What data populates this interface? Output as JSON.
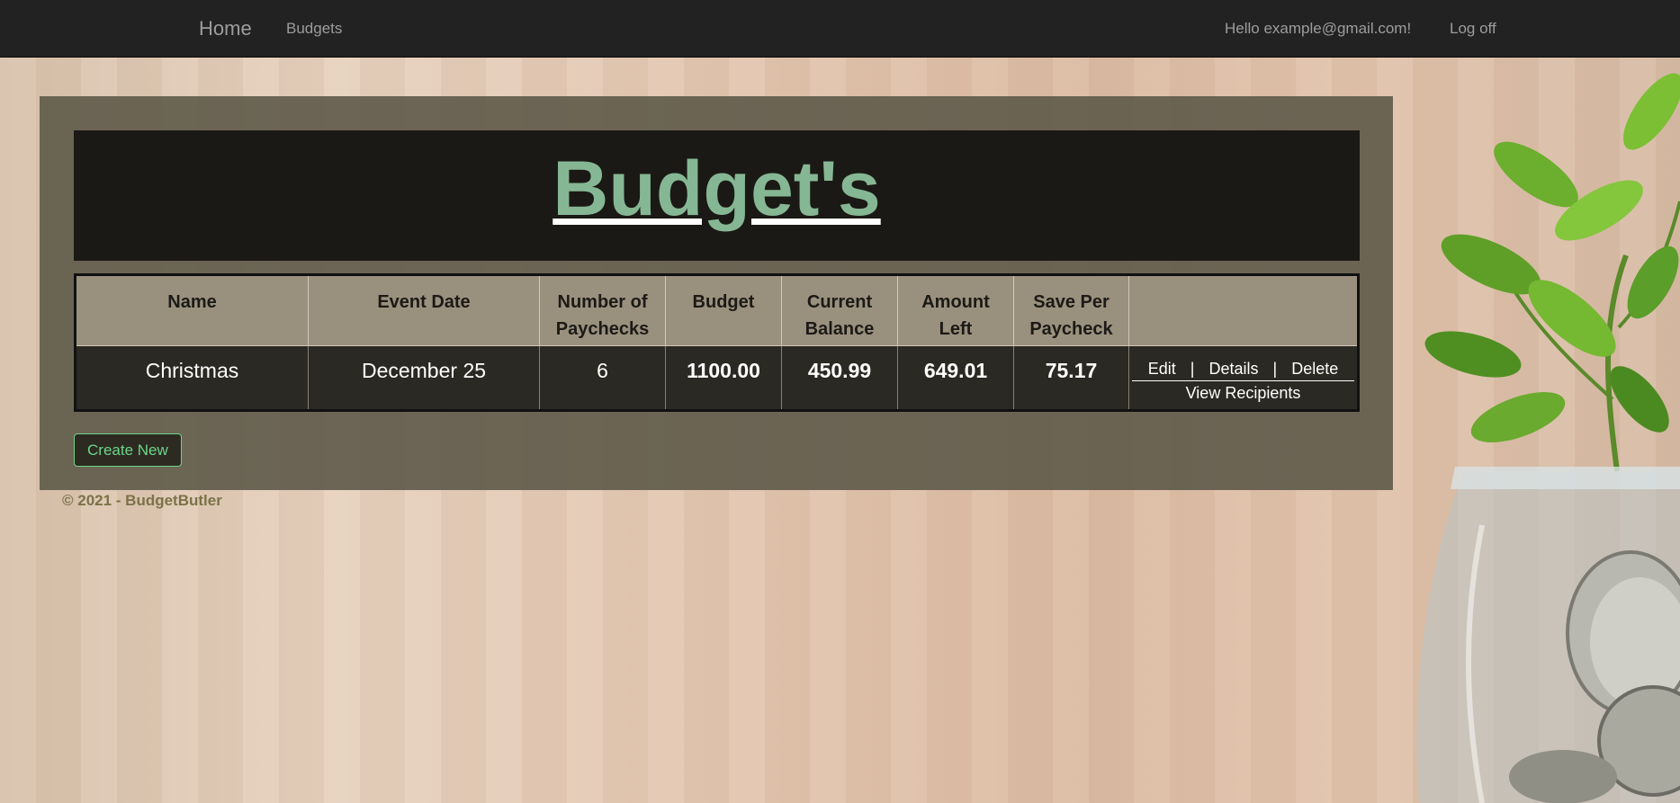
{
  "nav": {
    "brand": "Home",
    "budgets": "Budgets",
    "greeting": "Hello example@gmail.com!",
    "logoff": "Log off"
  },
  "page": {
    "title": "Budget's"
  },
  "table": {
    "headers": {
      "name": "Name",
      "event_date": "Event Date",
      "paychecks": "Number of Paychecks",
      "budget": "Budget",
      "current_balance": "Current Balance",
      "amount_left": "Amount Left",
      "save_per_paycheck": "Save Per Paycheck",
      "actions": ""
    },
    "rows": [
      {
        "name": "Christmas",
        "event_date": "December 25",
        "paychecks": "6",
        "budget": "1100.00",
        "current_balance": "450.99",
        "amount_left": "649.01",
        "save_per_paycheck": "75.17",
        "actions": {
          "edit": "Edit",
          "details": "Details",
          "delete": "Delete",
          "view_recipients": "View Recipients"
        }
      }
    ]
  },
  "create_new": "Create New",
  "footer": "© 2021 - BudgetButler",
  "colors": {
    "navbar": "#222222",
    "title": "#86b794",
    "budget": "#8ec3dc",
    "current_balance": "#e0183a",
    "amount_left": "#f2c43c",
    "save_per_paycheck": "#63c06c",
    "create_button": "#6cd58a"
  }
}
